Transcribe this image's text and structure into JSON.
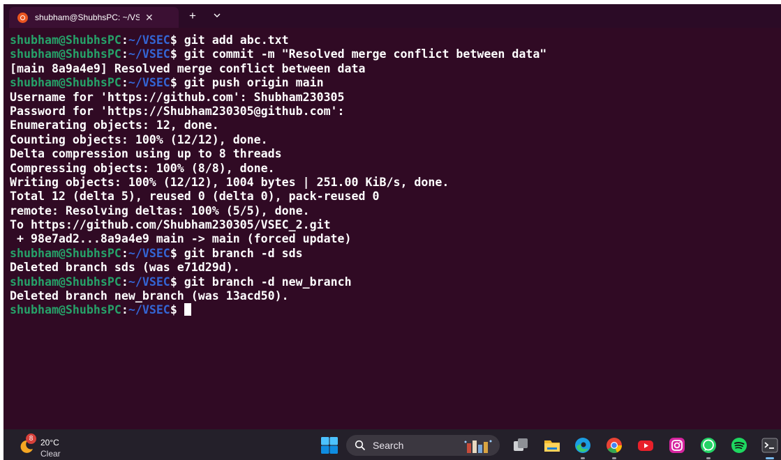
{
  "tab": {
    "title": "shubham@ShubhsPC: ~/VSEC",
    "close_glyph": "✕",
    "new_tab_glyph": "+",
    "dropdown_icon": "chevron-down-icon"
  },
  "terminal": {
    "prompt": {
      "user": "shubham@ShubhsPC",
      "colon": ":",
      "path": "~/VSEC",
      "symbol": "$"
    },
    "colors": {
      "background": "#300a24",
      "user": "#26a269",
      "path": "#3465d4",
      "text": "#ffffff"
    },
    "lines": [
      {
        "type": "cmd",
        "text": " git add abc.txt"
      },
      {
        "type": "cmd",
        "text": " git commit -m \"Resolved merge conflict between data\""
      },
      {
        "type": "out",
        "text": "[main 8a9a4e9] Resolved merge conflict between data"
      },
      {
        "type": "cmd",
        "text": " git push origin main"
      },
      {
        "type": "out",
        "text": "Username for 'https://github.com': Shubham230305"
      },
      {
        "type": "out",
        "text": "Password for 'https://Shubham230305@github.com':"
      },
      {
        "type": "out",
        "text": "Enumerating objects: 12, done."
      },
      {
        "type": "out",
        "text": "Counting objects: 100% (12/12), done."
      },
      {
        "type": "out",
        "text": "Delta compression using up to 8 threads"
      },
      {
        "type": "out",
        "text": "Compressing objects: 100% (8/8), done."
      },
      {
        "type": "out",
        "text": "Writing objects: 100% (12/12), 1004 bytes | 251.00 KiB/s, done."
      },
      {
        "type": "out",
        "text": "Total 12 (delta 5), reused 0 (delta 0), pack-reused 0"
      },
      {
        "type": "out",
        "text": "remote: Resolving deltas: 100% (5/5), done."
      },
      {
        "type": "out",
        "text": "To https://github.com/Shubham230305/VSEC_2.git"
      },
      {
        "type": "out",
        "text": " + 98e7ad2...8a9a4e9 main -> main (forced update)"
      },
      {
        "type": "cmd",
        "text": " git branch -d sds"
      },
      {
        "type": "out",
        "text": "Deleted branch sds (was e71d29d)."
      },
      {
        "type": "cmd",
        "text": " git branch -d new_branch"
      },
      {
        "type": "out",
        "text": "Deleted branch new_branch (was 13acd50)."
      },
      {
        "type": "prompt",
        "text": " "
      }
    ]
  },
  "taskbar": {
    "weather": {
      "temp": "20°C",
      "condition": "Clear",
      "badge": "8",
      "icon": "weather-moon-icon"
    },
    "search": {
      "label": "Search",
      "icon": "search-icon"
    },
    "apps": [
      {
        "name": "windows-start-icon"
      },
      {
        "name": "task-view-icon"
      },
      {
        "name": "file-explorer-icon"
      },
      {
        "name": "edge-browser-icon"
      },
      {
        "name": "chrome-browser-icon"
      },
      {
        "name": "youtube-icon"
      },
      {
        "name": "instagram-icon"
      },
      {
        "name": "whatsapp-icon"
      },
      {
        "name": "spotify-icon"
      },
      {
        "name": "terminal-icon"
      }
    ]
  }
}
